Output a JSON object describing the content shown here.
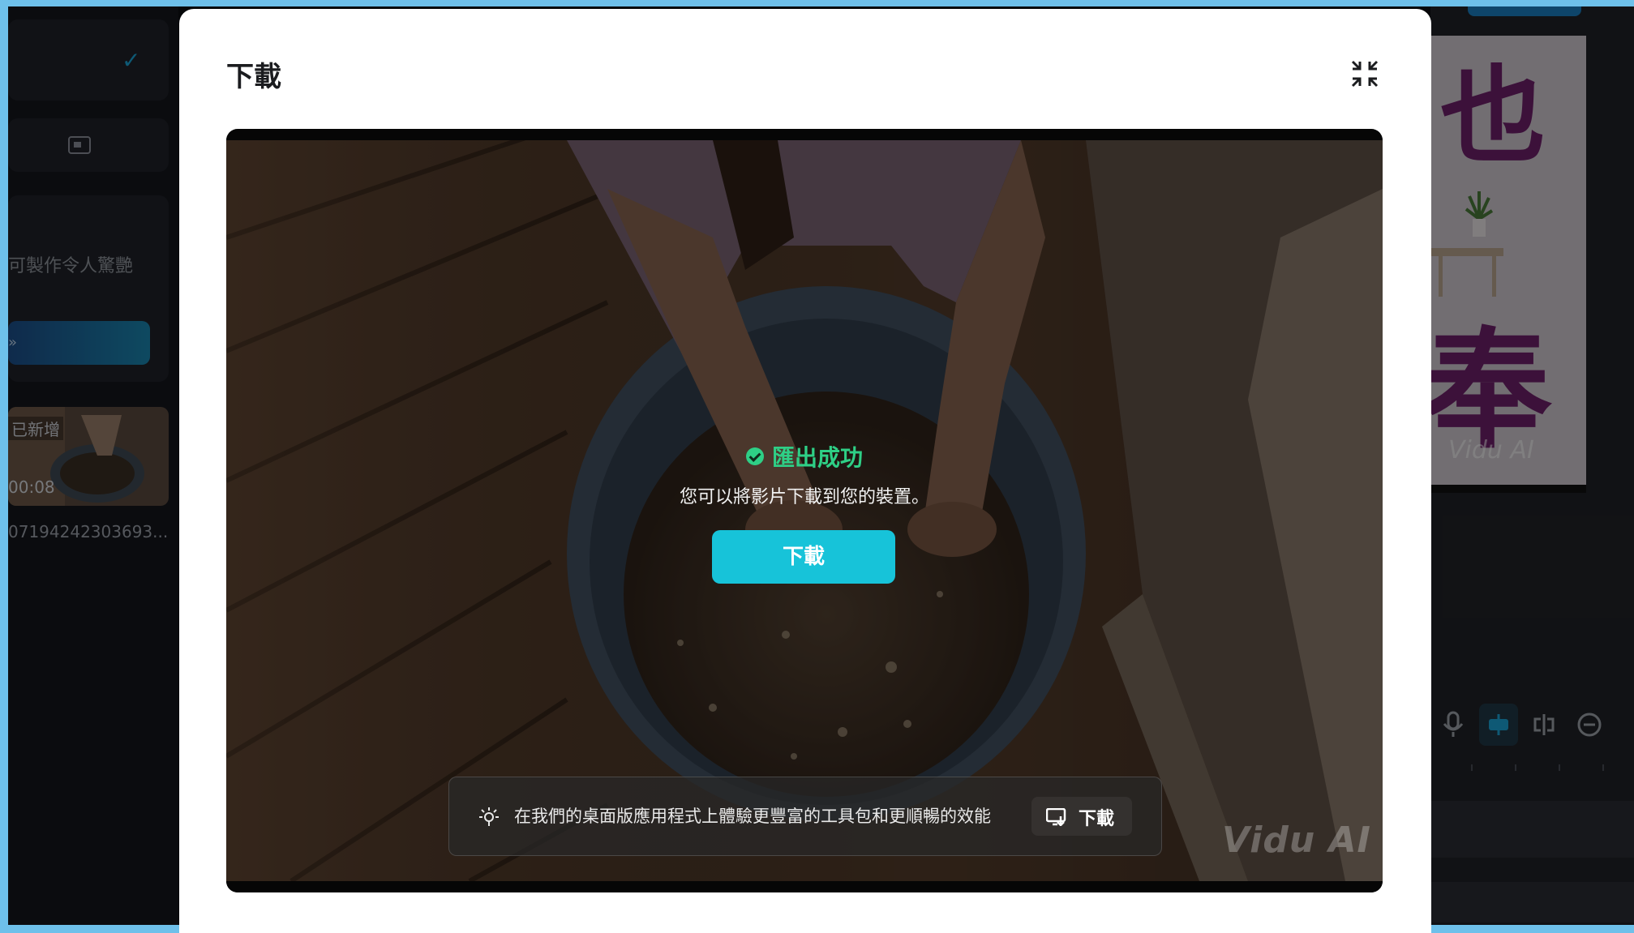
{
  "background_colors": {
    "frame": "#6ec0ea",
    "accent": "#17c3d9",
    "success": "#2ecf86"
  },
  "left_panel": {
    "description": "可製作令人驚艷",
    "thumbnail": {
      "badge": "已新增",
      "duration": "00:08"
    },
    "filename": "07194242303693..."
  },
  "right_panel": {
    "preview_chars": [
      "也",
      "奉"
    ],
    "watermark": "Vidu AI",
    "tools": [
      "mic-icon",
      "caption-icon",
      "split-icon",
      "zoom-out-icon"
    ]
  },
  "modal": {
    "title": "下載",
    "status": {
      "title": "匯出成功",
      "subtitle": "您可以將影片下載到您的裝置。"
    },
    "download_label": "下載",
    "promo": {
      "text": "在我們的桌面版應用程式上體驗更豐富的工具包和更順暢的效能",
      "button_label": "下載"
    },
    "watermark": "Vidu AI"
  }
}
